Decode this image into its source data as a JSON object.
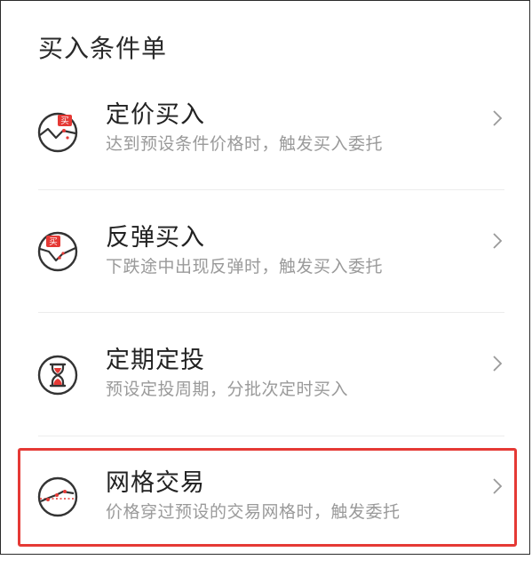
{
  "page": {
    "title": "买入条件单"
  },
  "items": [
    {
      "title": "定价买入",
      "desc": "达到预设条件价格时，触发买入委托",
      "icon": "price-buy-icon",
      "badge": "买"
    },
    {
      "title": "反弹买入",
      "desc": "下跌途中出现反弹时，触发买入委托",
      "icon": "rebound-buy-icon",
      "badge": "买"
    },
    {
      "title": "定期定投",
      "desc": "预设定投周期，分批次定时买入",
      "icon": "hourglass-icon"
    },
    {
      "title": "网格交易",
      "desc": "价格穿过预设的交易网格时，触发委托",
      "icon": "grid-trade-icon",
      "highlighted": true
    }
  ],
  "colors": {
    "accent_red": "#e53935",
    "icon_stroke": "#333333",
    "title_text": "#222222",
    "desc_text": "#9a9a9a",
    "divider": "#ececec"
  }
}
